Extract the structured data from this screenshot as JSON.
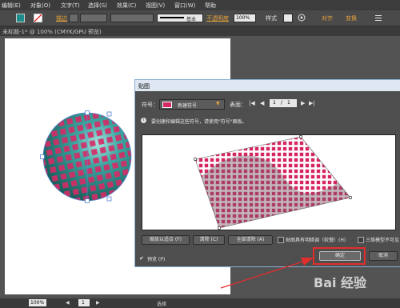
{
  "menubar": {
    "items": [
      {
        "label": "编辑(E)"
      },
      {
        "label": "对象(O)"
      },
      {
        "label": "文字(T)"
      },
      {
        "label": "选择(S)"
      },
      {
        "label": "效果(C)"
      },
      {
        "label": "视图(V)"
      },
      {
        "label": "窗口(W)"
      },
      {
        "label": "帮助"
      }
    ]
  },
  "controlbar": {
    "stroke_label": "描边",
    "stroke_style": "基本",
    "opacity_label": "不透明度",
    "opacity_value": "100%",
    "style_label": "样式",
    "btn_a": "对齐",
    "btn_b": "变换"
  },
  "doctab": {
    "title": "未标题-1* @ 100% (CMYK/GPU 预览)"
  },
  "dialog": {
    "title": "贴图",
    "symbol_label": "符号：",
    "symbol_value": "新建符号",
    "surface_label": "表面：",
    "page_value": "1",
    "page_sep": "/",
    "page_total": "1",
    "info_text": "要创建和编辑这些符号，请使用\"符号\"面板。",
    "buttons": {
      "fit": "缩放以适合 (F)",
      "clear": "清除 (C)",
      "clear_all": "全部清除 (A)",
      "ok": "确定",
      "cancel": "取消"
    },
    "shade_label": "贴图具有明暗调（较慢）(H)",
    "invisible_label": "三维模型不可见",
    "preview_label": "预览 (P)",
    "preview_checked": "✔"
  },
  "statusbar": {
    "zoom": "100%",
    "page": "1",
    "tool": "选择"
  },
  "watermark": {
    "text": "Bai 经验"
  },
  "colors": {
    "accent_red": "#e32d2d",
    "pattern_pink": "#d6245e",
    "sphere_teal": "#2f8f8c"
  }
}
